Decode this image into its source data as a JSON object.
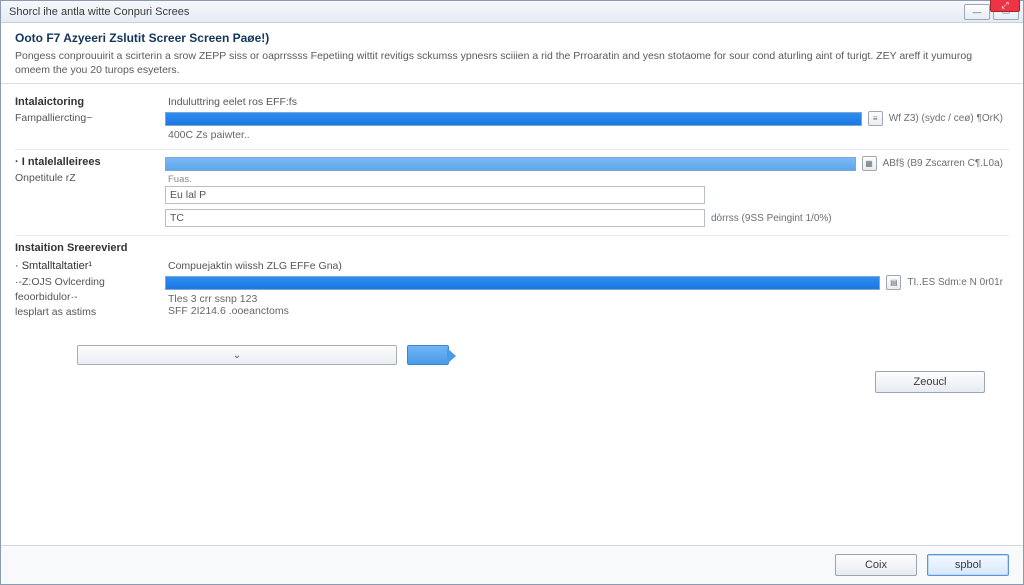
{
  "window": {
    "title": "Shorcl ihe antla witte Conpuri Screes",
    "close_glyph": "⤢"
  },
  "header": {
    "heading": "Ooto F7 Azyeeri Zslutit Screer Screen Paøe!)",
    "paragraph": "Pongess conprouuirit a scirterin a srow ZEPP siss or oaprrssss Fepetiing wittit revitigs sckumss ypnesrs sciiien a rid the Prroaratin and yesn stotaome for sour cond aturling aint of turigt. ZEY areff it yumurog omeem the you 20 turops esyeters."
  },
  "section1": {
    "title": "Intalaictoring",
    "sub1": "Fampalliercting~",
    "task_label": "Induluttring eelet ros EFF:fs",
    "progress_pct": 100,
    "status": "Wf Z3) (sydc / ceø) ¶OrK)",
    "note": "400C Zs paiwter.."
  },
  "section2": {
    "title": "· I ntalelalleirees",
    "sub1": "Onpetitule rZ",
    "progress_pct": 100,
    "status": "ABf§ (B9 Zscarren C¶.L0a)",
    "mini1": "Fuas.",
    "input1_value": "Eu lal P",
    "input2_value": "TC",
    "input2_status": "dòrrss  (9SS Peingint 1/0%)"
  },
  "section3": {
    "title": "Instaition Sreerevierd"
  },
  "section4": {
    "title": "· Smtalltaltatier¹",
    "sub1": "·-Z:OJS Ovlcerding",
    "sub2": "feoorbidulor·-",
    "sub3": "   lesplart as  astims",
    "task_label": "Compuejaktin wiissh ZLG EFFe Gna)",
    "progress_pct": 100,
    "status": "TI..ES Sdm:e N 0r01r",
    "note1": "Tles 3 crr ssnp 123",
    "note2": "SFF 2I214.6 .ooeanctoms"
  },
  "buttons": {
    "zeoucl": "Zeoucl",
    "coix": "Coix",
    "spbol": "spbol"
  },
  "dropdown": {
    "chevron": "⌄"
  }
}
